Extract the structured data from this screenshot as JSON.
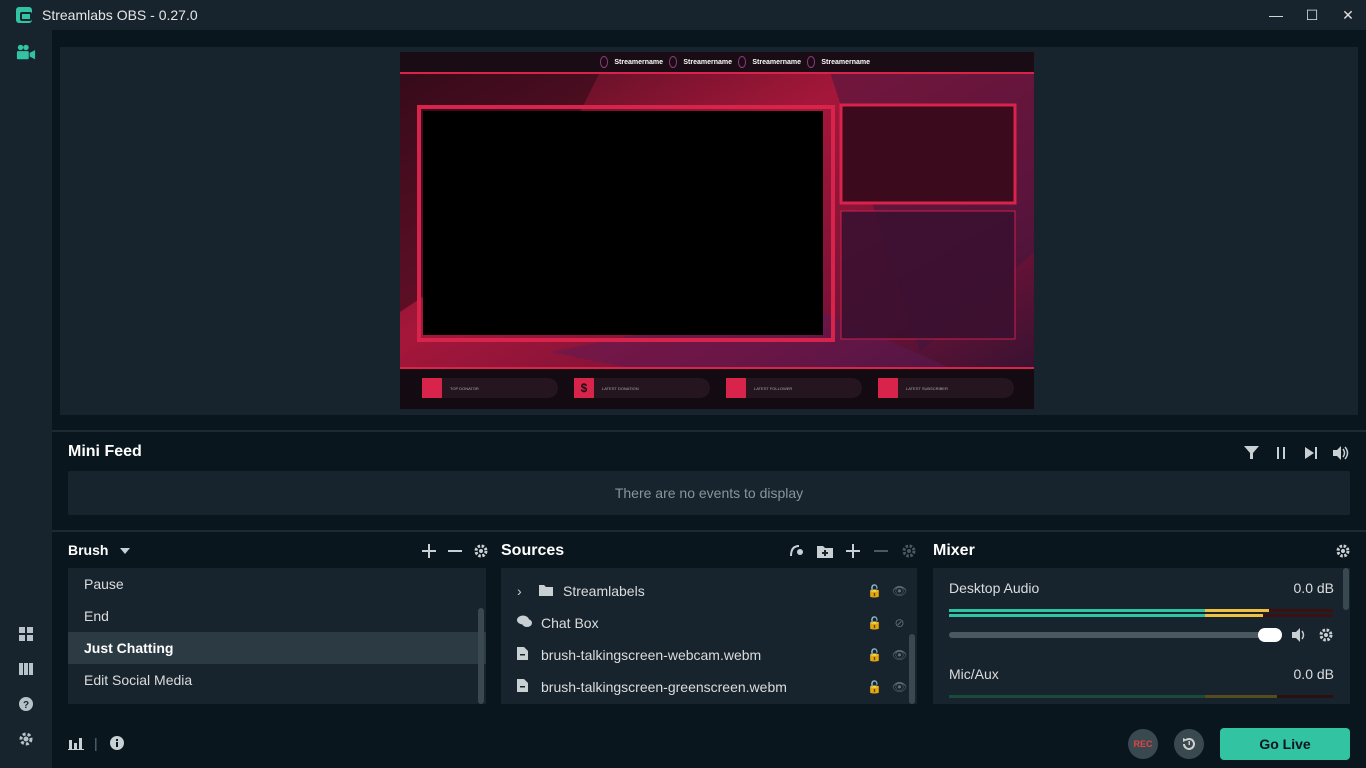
{
  "window": {
    "title": "Streamlabs OBS - 0.27.0",
    "minimize_glyph": "—",
    "maximize_glyph": "☐",
    "close_glyph": "✕"
  },
  "sidebar": {
    "top_icons": [
      "studio-camera-icon"
    ],
    "bottom_icons": [
      "layout-icon",
      "columns-icon",
      "help-icon",
      "settings-icon"
    ]
  },
  "overlay_preview": {
    "social_handles": [
      "Streamername",
      "Streamername",
      "Streamername",
      "Streamername"
    ],
    "alerts": [
      "TOP DONATOR",
      "LATEST DONATION",
      "LATEST FOLLOWER",
      "LATEST SUBSCRIBER"
    ],
    "accent_color": "#d8234b"
  },
  "minifeed": {
    "title": "Mini Feed",
    "empty_text": "There are no events to display",
    "icons": [
      "filter-icon",
      "pause-icon",
      "skip-icon",
      "volume-icon"
    ]
  },
  "scenes": {
    "collection_name": "Brush",
    "items": [
      "Pause",
      "End",
      "Just Chatting",
      "Edit Social Media"
    ],
    "selected": "Just Chatting"
  },
  "sources": {
    "title": "Sources",
    "items": [
      {
        "name": "Streamlabels",
        "type": "folder",
        "expand": "›"
      },
      {
        "name": "Chat Box",
        "type": "chat"
      },
      {
        "name": "brush-talkingscreen-webcam.webm",
        "type": "file"
      },
      {
        "name": "brush-talkingscreen-greenscreen.webm",
        "type": "file"
      }
    ]
  },
  "mixer": {
    "title": "Mixer",
    "channels": [
      {
        "name": "Desktop Audio",
        "level": "0.0 dB",
        "volume_fraction": 0.99
      },
      {
        "name": "Mic/Aux",
        "level": "0.0 dB"
      }
    ]
  },
  "footer": {
    "rec_label": "REC",
    "go_live_label": "Go Live",
    "separator": "|"
  },
  "colors": {
    "accent": "#31c3a2",
    "bg_dark": "#09161d",
    "bg_panel": "#17242d",
    "rec_red": "#e04545"
  }
}
